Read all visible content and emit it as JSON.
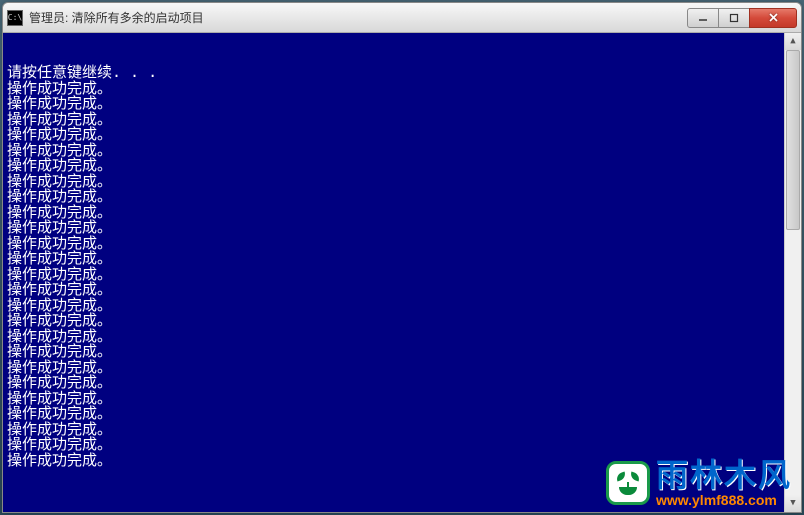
{
  "window": {
    "icon_text": "C:\\",
    "title": "管理员: 清除所有多余的启动项目"
  },
  "console": {
    "prompt_line": "请按任意键继续. . .",
    "success_line": "操作成功完成。",
    "success_count": 25
  },
  "watermark": {
    "brand": "雨林木风",
    "url": "www.ylmf888.com"
  },
  "colors": {
    "console_bg": "#000080",
    "console_fg": "#ffffff",
    "brand_blue": "#0066cc",
    "brand_orange": "#ff8800",
    "brand_green": "#1a9a4a"
  }
}
